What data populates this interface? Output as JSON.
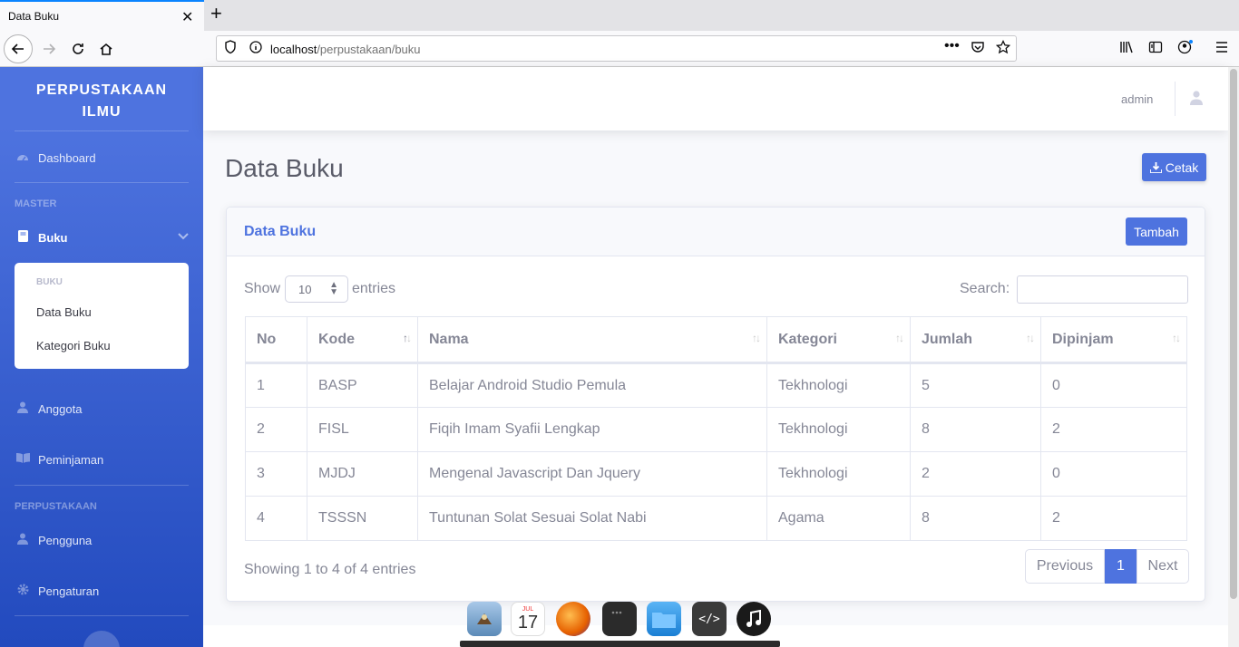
{
  "browser": {
    "tab_title": "Data Buku",
    "tab_close": "✕",
    "new_tab": "+",
    "url_host": "localhost",
    "url_path": "/perpustakaan/buku"
  },
  "sidebar": {
    "brand_line1": "PERPUSTAKAAN",
    "brand_line2": "ILMU",
    "dashboard": "Dashboard",
    "heading_master": "MASTER",
    "buku": "Buku",
    "collapse_heading": "BUKU",
    "data_buku": "Data Buku",
    "kategori_buku": "Kategori Buku",
    "anggota": "Anggota",
    "peminjaman": "Peminjaman",
    "heading_perpustakaan": "PERPUSTAKAAN",
    "pengguna": "Pengguna",
    "pengaturan": "Pengaturan"
  },
  "topbar": {
    "user_name": "admin"
  },
  "main": {
    "page_title": "Data Buku",
    "cetak_label": "Cetak",
    "card_title": "Data Buku",
    "tambah_label": "Tambah",
    "show_label": "Show",
    "entries_value": "10",
    "entries_label": "entries",
    "search_label": "Search:",
    "search_value": "",
    "columns": [
      "No",
      "Kode",
      "Nama",
      "Kategori",
      "Jumlah",
      "Dipinjam"
    ],
    "rows": [
      [
        "1",
        "BASP",
        "Belajar Android Studio Pemula",
        "Tekhnologi",
        "5",
        "0"
      ],
      [
        "2",
        "FISL",
        "Fiqih Imam Syafii Lengkap",
        "Tekhnologi",
        "8",
        "2"
      ],
      [
        "3",
        "MJDJ",
        "Mengenal Javascript Dan Jquery",
        "Tekhnologi",
        "2",
        "0"
      ],
      [
        "4",
        "TSSSN",
        "Tuntunan Solat Sesuai Solat Nabi",
        "Agama",
        "8",
        "2"
      ]
    ],
    "info_text": "Showing 1 to 4 of 4 entries",
    "pagination": {
      "previous": "Previous",
      "current": "1",
      "next": "Next"
    }
  },
  "dock": {
    "calendar_month": "JUL",
    "calendar_day": "17",
    "apps": [
      "finder-icon",
      "calendar-icon",
      "firefox-icon",
      "terminal-icon",
      "files-icon",
      "code-editor-icon",
      "music-icon"
    ]
  },
  "colors": {
    "primary": "#4e73df",
    "sidebar_gradient_end": "#224abe",
    "text_muted": "#858796"
  }
}
